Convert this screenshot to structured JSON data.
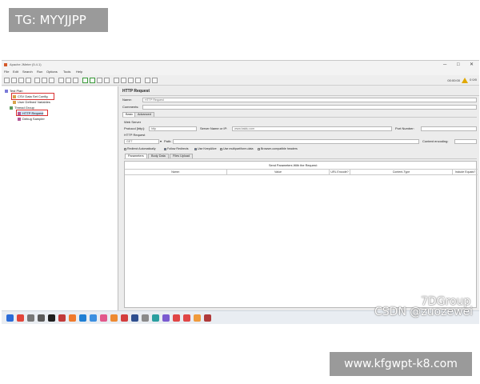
{
  "overlays": {
    "top_tag": "TG: MYYJJPP",
    "bottom_tag": "www.kfgwpt-k8.com"
  },
  "window": {
    "title": "Apache JMeter (5.4.1)",
    "minimize_glyph": "─",
    "maximize_glyph": "□",
    "close_glyph": "✕",
    "menu": [
      "File",
      "Edit",
      "Search",
      "Run",
      "Options",
      "Tools",
      "Help"
    ],
    "toolbar_status": "00:00:00",
    "warning_count": "0 0/0",
    "accent": "#d45a2a"
  },
  "tree": {
    "nodes": [
      {
        "label": "Test Plan",
        "icon": "test-plan-icon"
      },
      {
        "label": "CSV Data Set Config",
        "icon": "config-icon"
      },
      {
        "label": "User Defined Variables",
        "icon": "config-icon"
      },
      {
        "label": "Thread Group",
        "icon": "thread-group-icon"
      },
      {
        "label": "HTTP Request",
        "icon": "sampler-icon"
      },
      {
        "label": "Debug Sampler",
        "icon": "sampler-icon"
      }
    ],
    "highlight_color": "#d93030"
  },
  "panel": {
    "title": "HTTP Request",
    "name_label": "Name:",
    "name_value": "HTTP Request",
    "comments_label": "Comments:",
    "tabs": [
      "Basic",
      "Advanced"
    ],
    "web_server_title": "Web Server",
    "protocol_label": "Protocol [http]:",
    "protocol_value": "http",
    "server_label": "Server Name or IP:",
    "server_value": "www.baidu.com",
    "port_label": "Port Number:",
    "http_request_title": "HTTP Request",
    "method_value": "GET",
    "path_label": "Path:",
    "encoding_label": "Content encoding:",
    "checkboxes": [
      {
        "label": "Redirect Automatically",
        "checked": false
      },
      {
        "label": "Follow Redirects",
        "checked": true
      },
      {
        "label": "Use KeepAlive",
        "checked": true
      },
      {
        "label": "Use multipart/form-data",
        "checked": false
      },
      {
        "label": "Browser-compatible headers",
        "checked": false
      }
    ],
    "subtabs": [
      "Parameters",
      "Body Data",
      "Files Upload"
    ],
    "params_caption": "Send Parameters With the Request:",
    "columns": [
      "Name:",
      "Value",
      "URL Encode?",
      "Content-Type",
      "Include Equals?"
    ]
  },
  "taskbar": {
    "icons": [
      {
        "name": "start-icon",
        "color": "#2b6cd8"
      },
      {
        "name": "chrome-icon",
        "color": "#e3453a"
      },
      {
        "name": "search-icon",
        "color": "#777777"
      },
      {
        "name": "camera-icon",
        "color": "#5a5a5a"
      },
      {
        "name": "terminal-icon",
        "color": "#1f1f1f"
      },
      {
        "name": "pen-icon",
        "color": "#c23a3a"
      },
      {
        "name": "postman-icon",
        "color": "#f07a2c"
      },
      {
        "name": "vscode-icon",
        "color": "#1f7fd4"
      },
      {
        "name": "app-blue-icon",
        "color": "#3c8fe0"
      },
      {
        "name": "app-pink-icon",
        "color": "#e2588b"
      },
      {
        "name": "app-orange-icon",
        "color": "#ee8a32"
      },
      {
        "name": "app-red-icon",
        "color": "#d33e3e"
      },
      {
        "name": "app-dark-icon",
        "color": "#2f4f8f"
      },
      {
        "name": "app-gray-icon",
        "color": "#8a8a8a"
      },
      {
        "name": "app-teal-icon",
        "color": "#2a9fa0"
      },
      {
        "name": "app-violet-icon",
        "color": "#7a5ad0"
      },
      {
        "name": "app-red2-icon",
        "color": "#e04646"
      },
      {
        "name": "wps-icon",
        "color": "#e04646"
      },
      {
        "name": "app-orange2-icon",
        "color": "#f09a3c"
      },
      {
        "name": "pen2-icon",
        "color": "#b03a3a"
      }
    ]
  },
  "watermark": {
    "group": "7DGroup",
    "source": "CSDN @zuozewei"
  }
}
